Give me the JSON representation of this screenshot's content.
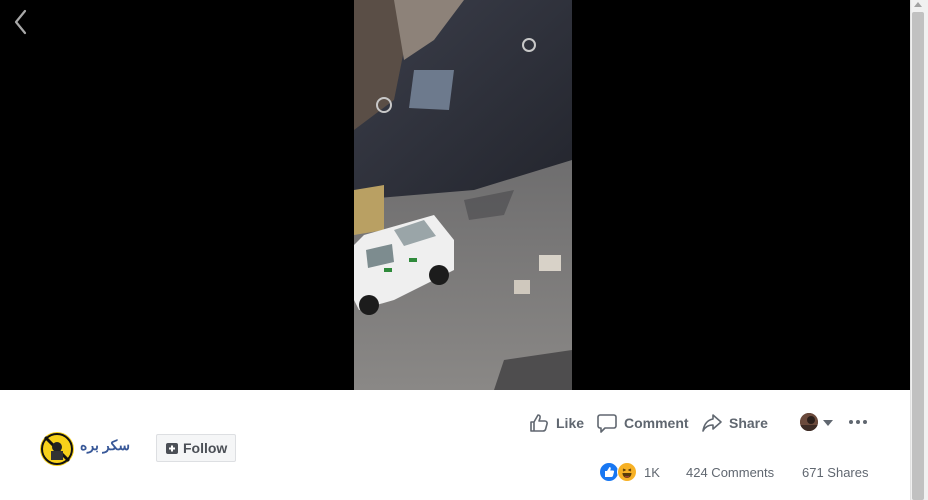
{
  "post": {
    "page_name": "سكر بره",
    "follow_label": "Follow"
  },
  "actions": {
    "like_label": "Like",
    "comment_label": "Comment",
    "share_label": "Share"
  },
  "stats": {
    "reaction_count": "1K",
    "comments": "424 Comments",
    "shares": "671 Shares"
  },
  "icons": {
    "back": "chevron-left-icon",
    "like": "thumbs-up-icon",
    "comment": "speech-bubble-icon",
    "share": "share-arrow-icon",
    "more": "ellipsis-icon",
    "follow": "follow-plus-icon"
  },
  "colors": {
    "link_blue": "#385898",
    "text_gray": "#606770",
    "like_blue": "#1877f2",
    "haha_yellow": "#f7b125",
    "viewer_bg": "#000000"
  }
}
